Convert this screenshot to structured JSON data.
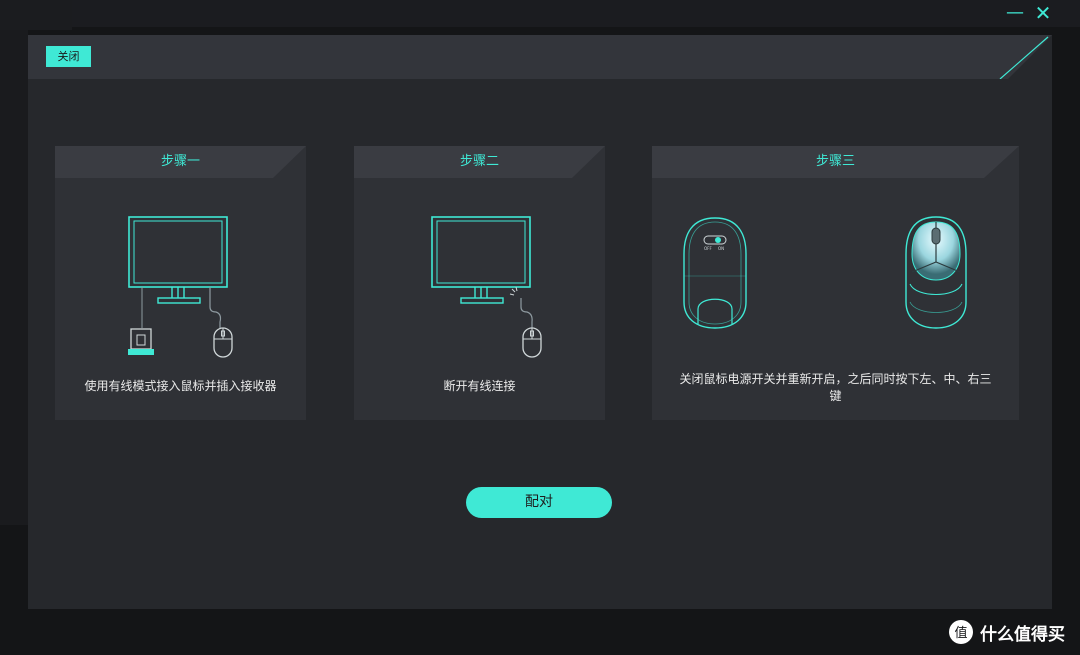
{
  "window": {
    "minimize_glyph": "—",
    "close_glyph": "✕"
  },
  "header": {
    "close_label": "关闭"
  },
  "steps": [
    {
      "title": "步骤一",
      "description": "使用有线模式接入鼠标并插入接收器",
      "icons": [
        "monitor-icon",
        "usb-receiver-icon",
        "mouse-icon"
      ]
    },
    {
      "title": "步骤二",
      "description": "断开有线连接",
      "icons": [
        "monitor-icon",
        "mouse-icon"
      ]
    },
    {
      "title": "步骤三",
      "description": "关闭鼠标电源开关并重新开启，之后同时按下左、中、右三键",
      "switch_labels": [
        "OFF",
        "ON"
      ],
      "icons": [
        "mouse-bottom-icon",
        "mouse-top-icon"
      ]
    }
  ],
  "pair_button_label": "配对",
  "watermark": {
    "text": "什么值得买",
    "logo_char": "值"
  },
  "colors": {
    "accent": "#3fe9d5",
    "panel": "#26282c",
    "card": "#2f3136"
  }
}
